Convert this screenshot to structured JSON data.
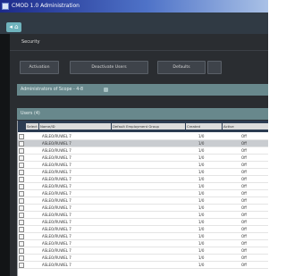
{
  "window": {
    "title": "CMOD 1.0 Administration"
  },
  "toolbar": {
    "back_label": "◂ ⌂"
  },
  "breadcrumb": "Security",
  "actions": [
    {
      "label": "Activation"
    },
    {
      "label": "Deactivate Users"
    },
    {
      "label": "Defaults"
    }
  ],
  "panels": {
    "filter_label": "Administrators of Scope - 4-8",
    "group_label": "Users (4)"
  },
  "grid": {
    "columns": [
      "Select",
      "Name/ID",
      "Default Employment Group",
      "Created",
      "Active"
    ],
    "rows": [
      {
        "name": "ASLEO/RUWEL 7",
        "created": "1/0",
        "active": "Off",
        "selected": false
      },
      {
        "name": "ASLEO/RUWEL 7",
        "created": "1/0",
        "active": "Off",
        "selected": true
      },
      {
        "name": "ASLEO/RUWEL 7",
        "created": "1/0",
        "active": "Off",
        "selected": false
      },
      {
        "name": "ASLEO/RUWEL 7",
        "created": "1/0",
        "active": "Off",
        "selected": false
      },
      {
        "name": "ASLEO/RUWEL 7",
        "created": "1/0",
        "active": "Off",
        "selected": false
      },
      {
        "name": "ASLEO/RUWEL 7",
        "created": "1/0",
        "active": "Off",
        "selected": false
      },
      {
        "name": "ASLEO/RUWEL 7",
        "created": "1/0",
        "active": "Off",
        "selected": false
      },
      {
        "name": "ASLEO/RUWEL 7",
        "created": "1/0",
        "active": "Off",
        "selected": false
      },
      {
        "name": "ASLEO/RUWEL 7",
        "created": "1/0",
        "active": "Off",
        "selected": false
      },
      {
        "name": "ASLEO/RUWEL 7",
        "created": "1/0",
        "active": "Off",
        "selected": false
      },
      {
        "name": "ASLEO/RUWEL 7",
        "created": "1/0",
        "active": "Off",
        "selected": false
      },
      {
        "name": "ASLEO/RUWEL 7",
        "created": "1/0",
        "active": "Off",
        "selected": false
      },
      {
        "name": "ASLEO/RUWEL 7",
        "created": "1/0",
        "active": "Off",
        "selected": false
      },
      {
        "name": "ASLEO/RUWEL 7",
        "created": "1/0",
        "active": "Off",
        "selected": false
      },
      {
        "name": "ASLEO/RUWEL 7",
        "created": "1/0",
        "active": "Off",
        "selected": false
      },
      {
        "name": "ASLEO/RUWEL 7",
        "created": "1/0",
        "active": "Off",
        "selected": false
      },
      {
        "name": "ASLEO/RUWEL 7",
        "created": "1/0",
        "active": "Off",
        "selected": false
      },
      {
        "name": "ASLEO/RUWEL 7",
        "created": "1/0",
        "active": "Off",
        "selected": false
      },
      {
        "name": "ASLEO/RUWEL 7",
        "created": "1/0",
        "active": "Off",
        "selected": false
      }
    ]
  },
  "colors": {
    "accent": "#6fb3bd",
    "panel_bar": "#68888c",
    "grid_header": "#2c3c52",
    "selected_row": "#c9ccd0"
  }
}
